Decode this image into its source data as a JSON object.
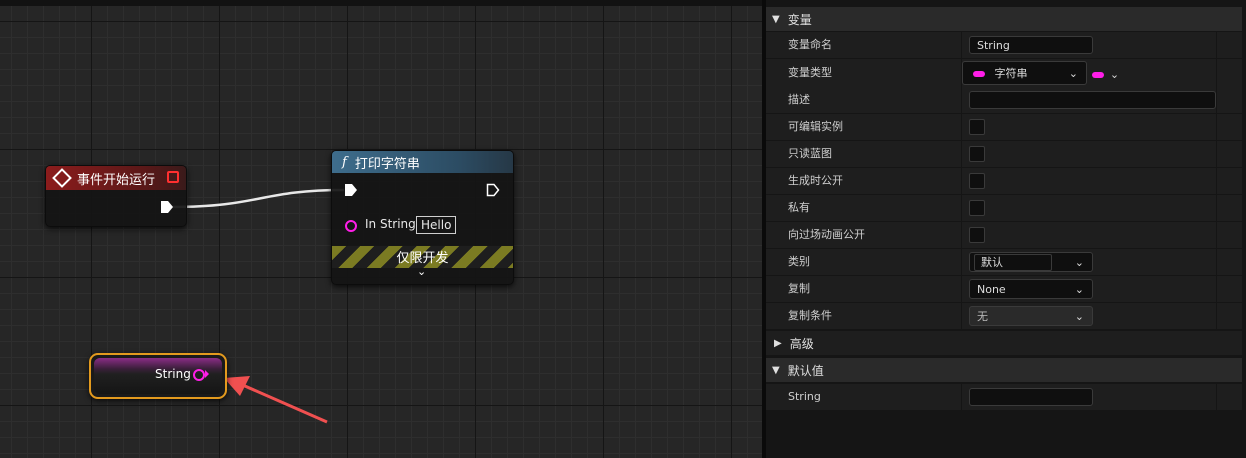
{
  "graph": {
    "event_node": {
      "title": "事件开始运行"
    },
    "print_node": {
      "title": "打印字符串",
      "func_glyph": "f",
      "in_string_label": "In String",
      "in_string_value": "Hello",
      "dev_only_label": "仅限开发"
    },
    "variable_node": {
      "label": "String"
    }
  },
  "details": {
    "variable_section": "变量",
    "rows": {
      "name": {
        "label": "变量命名",
        "value": "String"
      },
      "type": {
        "label": "变量类型",
        "value": "字符串"
      },
      "description": {
        "label": "描述",
        "value": ""
      },
      "instance_editable": {
        "label": "可编辑实例"
      },
      "blueprint_readonly": {
        "label": "只读蓝图"
      },
      "expose_on_spawn": {
        "label": "生成时公开"
      },
      "private": {
        "label": "私有"
      },
      "expose_cinematics": {
        "label": "向过场动画公开"
      },
      "category": {
        "label": "类别",
        "value": "默认"
      },
      "replication": {
        "label": "复制",
        "value": "None"
      },
      "replication_condition": {
        "label": "复制条件",
        "value": "无"
      }
    },
    "advanced_section": "高级",
    "default_section": "默认值",
    "default_row": {
      "label": "String",
      "value": ""
    }
  },
  "colors": {
    "string_pin": "#ff1ee8",
    "selection": "#e39a1e",
    "event_header": "#8c1c1c",
    "function_header": "#3e6d8c",
    "arrow": "#f05050"
  }
}
